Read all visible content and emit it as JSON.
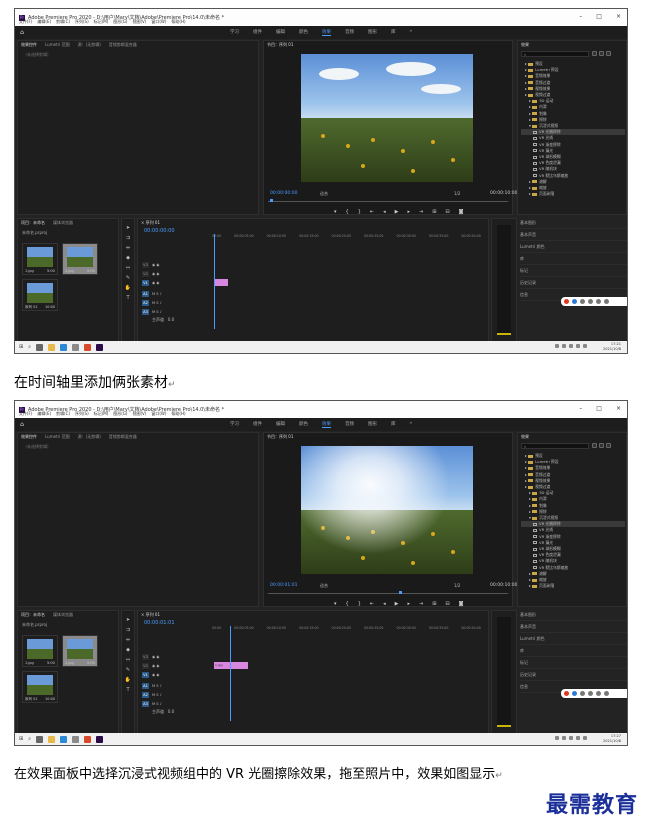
{
  "app": {
    "title": "Adobe Premiere Pro 2020 - D:\\用户\\Mary\\文档\\Adobe\\Premiere Pro\\14.0\\未命名 *",
    "menu": [
      "文件(F)",
      "编辑(E)",
      "剪辑(C)",
      "序列(S)",
      "标记(M)",
      "图形(G)",
      "视图(V)",
      "窗口(W)",
      "帮助(H)"
    ],
    "window_controls": [
      "–",
      "□",
      "×"
    ],
    "workspaces": [
      "学习",
      "组件",
      "编辑",
      "颜色",
      "效果",
      "音频",
      "图形",
      "库",
      "»"
    ],
    "active_workspace": "效果"
  },
  "source_panel": {
    "tabs": [
      "效果控件",
      "Lumetri 范围",
      "源：(无剪辑)",
      "音频剪辑混合器"
    ],
    "label": "（未选择剪辑）"
  },
  "program_panel": {
    "tab": "节目：序列 01",
    "fit": "适合",
    "resolution": "1/2",
    "shot1": {
      "timecode": "00:00:00:00",
      "duration": "00:00:10:00"
    },
    "shot2": {
      "timecode": "00:00:01:01",
      "duration": "00:00:10:00"
    }
  },
  "effects_panel": {
    "tab": "效果",
    "tree": [
      {
        "label": "预设",
        "type": "folder",
        "indent": 1
      },
      {
        "label": "Lumetri 预设",
        "type": "folder",
        "indent": 1
      },
      {
        "label": "音频效果",
        "type": "folder",
        "indent": 1
      },
      {
        "label": "音频过渡",
        "type": "folder",
        "indent": 1
      },
      {
        "label": "视频效果",
        "type": "folder",
        "indent": 1
      },
      {
        "label": "视频过渡",
        "type": "folder",
        "indent": 1
      },
      {
        "label": "3D 运动",
        "type": "folder",
        "indent": 2
      },
      {
        "label": "内滑",
        "type": "folder",
        "indent": 2
      },
      {
        "label": "划像",
        "type": "folder",
        "indent": 2
      },
      {
        "label": "擦除",
        "type": "folder",
        "indent": 2
      },
      {
        "label": "沉浸式视频",
        "type": "folder",
        "indent": 2,
        "open": true
      },
      {
        "label": "VR 光圈擦除",
        "type": "fx",
        "indent": 3,
        "selected": true
      },
      {
        "label": "VR 光线",
        "type": "fx",
        "indent": 3
      },
      {
        "label": "VR 渐变擦除",
        "type": "fx",
        "indent": 3
      },
      {
        "label": "VR 漏光",
        "type": "fx",
        "indent": 3
      },
      {
        "label": "VR 球形模糊",
        "type": "fx",
        "indent": 3
      },
      {
        "label": "VR 色度泄漏",
        "type": "fx",
        "indent": 3
      },
      {
        "label": "VR 随机块",
        "type": "fx",
        "indent": 3
      },
      {
        "label": "VR 默比乌斯缩放",
        "type": "fx",
        "indent": 3
      },
      {
        "label": "溶解",
        "type": "folder",
        "indent": 2
      },
      {
        "label": "缩放",
        "type": "folder",
        "indent": 2
      },
      {
        "label": "页面剥落",
        "type": "folder",
        "indent": 2
      }
    ],
    "side_list": [
      "基本图形",
      "基本声音",
      "Lumetri 颜色",
      "库",
      "标记",
      "历史记录",
      "信息"
    ]
  },
  "project_panel": {
    "tabs": [
      "项目：未命名",
      "媒体浏览器"
    ],
    "file": "未命名.prproj",
    "thumb1": {
      "name": "1.jpg",
      "dur": "5:00"
    },
    "thumb2": {
      "name": "2.jpg",
      "dur": "5:00"
    },
    "thumb3": {
      "name": "序列 01",
      "dur": "10:00"
    }
  },
  "timeline": {
    "tab": "× 序列 01",
    "shot1_tc": "00:00:00:00",
    "shot2_tc": "00:00:01:01",
    "ruler": [
      "00:00",
      "00:00:05:00",
      "00:00:10:00",
      "00:00:15:00",
      "00:00:20:00",
      "00:00:25:00",
      "00:00:30:00",
      "00:00:35:00",
      "00:00:40:00",
      "00:00:45:00"
    ],
    "video_tracks": [
      "V3",
      "V2",
      "V1"
    ],
    "audio_tracks": [
      "A1",
      "A2",
      "A3"
    ],
    "master": "主声道",
    "master_val": "0.0",
    "clip_label": "1.jpg"
  },
  "taskbar": {
    "time1": "17:21",
    "time2": "17:27",
    "date": "2021/10/8"
  },
  "captions": {
    "step1": "在时间轴里添加俩张素材",
    "step2": "在效果面板中选择沉浸式视频组中的 VR 光圈擦除效果，拖至照片中，效果如图显示"
  },
  "watermark": "最需教育"
}
